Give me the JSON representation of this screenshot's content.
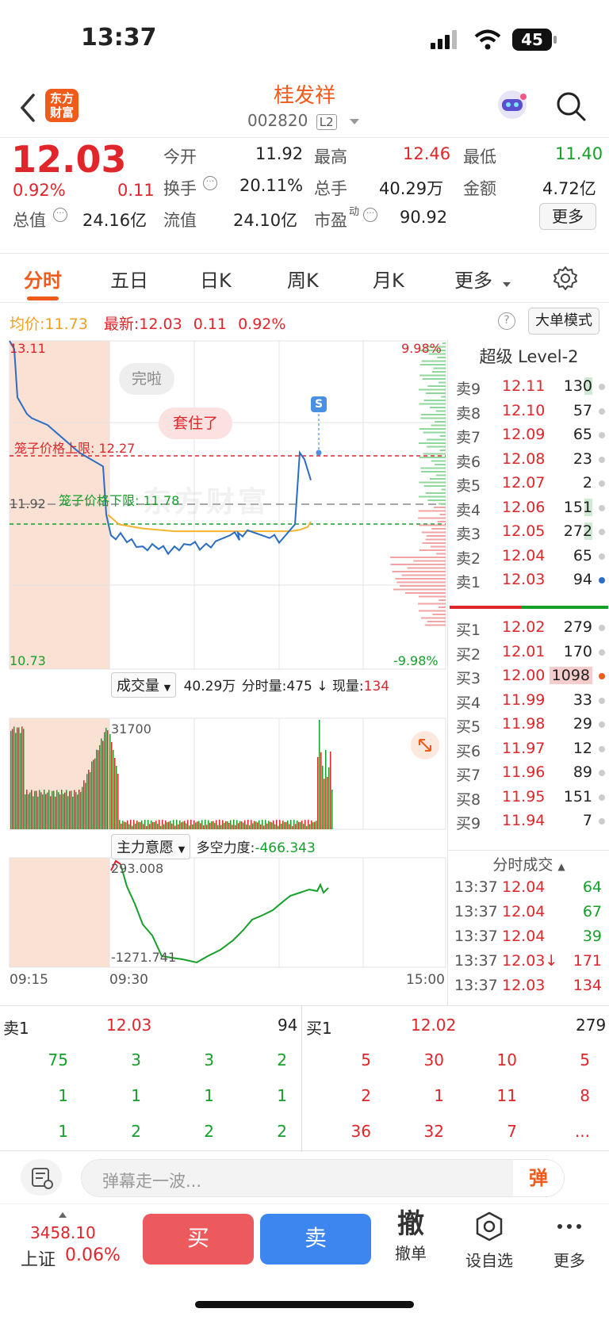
{
  "status": {
    "time": "13:37",
    "battery": "45"
  },
  "header": {
    "logo_line1": "东方",
    "logo_line2": "财富",
    "stock_name": "桂发祥",
    "stock_code": "002820",
    "level_badge": "L2"
  },
  "quote": {
    "price": "12.03",
    "change_pct": "0.92%",
    "change": "0.11",
    "open_label": "今开",
    "open": "11.92",
    "high_label": "最高",
    "high": "12.46",
    "low_label": "最低",
    "low": "11.40",
    "turnover_label": "换手",
    "turnover": "20.11%",
    "volume_label": "总手",
    "volume": "40.29万",
    "amount_label": "金额",
    "amount": "4.72亿",
    "mktcap_label": "总值",
    "mktcap": "24.16亿",
    "float_label": "流值",
    "float_cap": "24.10亿",
    "pe_label": "市盈",
    "pe_sup": "动",
    "pe": "90.92",
    "more_label": "更多"
  },
  "tabs": [
    "分时",
    "五日",
    "日K",
    "周K",
    "月K",
    "更多"
  ],
  "avgline": {
    "avg_label": "均价:",
    "avg": "11.73",
    "latest_label": "最新:",
    "latest": "12.03",
    "chg": "0.11",
    "pct": "0.92%",
    "bigorder_label": "大单模式"
  },
  "chart": {
    "top_price": "13.11",
    "bottom_price": "10.73",
    "prev_close": "11.92",
    "top_pct": "9.98%",
    "bottom_pct": "-9.98%",
    "upper_limit_label": "笼子价格上限:",
    "upper_limit": "12.27",
    "lower_limit_label": "笼子价格下限:",
    "lower_limit": "11.78",
    "tag1": "完啦",
    "tag2": "套住了",
    "s_marker": "S",
    "watermark": "东方财富",
    "vol_selector": "成交量",
    "vol_total": "40.29万",
    "vol_minute_label": "分时量:",
    "vol_minute": "475",
    "vol_now_label": "现量:",
    "vol_now": "134",
    "vol_max": "31700",
    "ind_selector": "主力意愿",
    "ind_label": "多空力度:",
    "ind_value": "-466.343",
    "ind_top": "293.008",
    "ind_bottom": "-1271.741",
    "time_start": "09:15",
    "time_open": "09:30",
    "time_end": "15:00"
  },
  "chart_data": {
    "type": "line",
    "title": "",
    "ylim": [
      10.73,
      13.11
    ],
    "x_range": [
      "09:15",
      "15:00"
    ],
    "series": [
      {
        "values": [
          13.11,
          13.05,
          12.7,
          12.58,
          12.55,
          12.5,
          12.3,
          12.2,
          11.85,
          11.7,
          11.65,
          11.62,
          11.6,
          11.62,
          11.63,
          11.64,
          11.7,
          11.72,
          11.68,
          11.78,
          12.3,
          12.25,
          12.1
        ]
      },
      {
        "values": [
          11.85,
          11.78,
          11.75,
          11.73,
          11.73,
          11.73,
          11.73,
          11.73,
          11.74,
          11.76,
          11.8
        ]
      }
    ]
  },
  "level2": {
    "title": "超级 Level-2",
    "asks": [
      {
        "label": "卖9",
        "price": "12.11",
        "vol": "130"
      },
      {
        "label": "卖8",
        "price": "12.10",
        "vol": "57"
      },
      {
        "label": "卖7",
        "price": "12.09",
        "vol": "65"
      },
      {
        "label": "卖6",
        "price": "12.08",
        "vol": "23"
      },
      {
        "label": "卖5",
        "price": "12.07",
        "vol": "2"
      },
      {
        "label": "卖4",
        "price": "12.06",
        "vol": "151"
      },
      {
        "label": "卖3",
        "price": "12.05",
        "vol": "272"
      },
      {
        "label": "卖2",
        "price": "12.04",
        "vol": "65"
      },
      {
        "label": "卖1",
        "price": "12.03",
        "vol": "94"
      }
    ],
    "bids": [
      {
        "label": "买1",
        "price": "12.02",
        "vol": "279"
      },
      {
        "label": "买2",
        "price": "12.01",
        "vol": "170"
      },
      {
        "label": "买3",
        "price": "12.00",
        "vol": "1098"
      },
      {
        "label": "买4",
        "price": "11.99",
        "vol": "33"
      },
      {
        "label": "买5",
        "price": "11.98",
        "vol": "29"
      },
      {
        "label": "买6",
        "price": "11.97",
        "vol": "12"
      },
      {
        "label": "买7",
        "price": "11.96",
        "vol": "89"
      },
      {
        "label": "买8",
        "price": "11.95",
        "vol": "151"
      },
      {
        "label": "买9",
        "price": "11.94",
        "vol": "7"
      }
    ],
    "ticks_title": "分时成交",
    "ticks": [
      {
        "time": "13:37",
        "price": "12.04",
        "vol": "64"
      },
      {
        "time": "13:37",
        "price": "12.04",
        "vol": "67"
      },
      {
        "time": "13:37",
        "price": "12.04",
        "vol": "39"
      },
      {
        "time": "13:37",
        "price": "12.03↓",
        "vol": "171"
      },
      {
        "time": "13:37",
        "price": "12.03",
        "vol": "134"
      }
    ]
  },
  "orderbook": {
    "sell_label": "卖1",
    "sell_price": "12.03",
    "sell_vol": "94",
    "buy_label": "买1",
    "buy_price": "12.02",
    "buy_vol": "279",
    "sell_queue": [
      "75",
      "3",
      "3",
      "2",
      "1",
      "1",
      "1",
      "1",
      "1",
      "2",
      "2",
      "2"
    ],
    "buy_queue": [
      "5",
      "30",
      "10",
      "5",
      "2",
      "1",
      "11",
      "8",
      "36",
      "32",
      "7",
      "..."
    ]
  },
  "danmu": {
    "placeholder": "弹幕走一波...",
    "btn": "弹"
  },
  "bottom": {
    "index_value": "3458.10",
    "index_name": "上证",
    "index_pct": "0.06%",
    "buy": "买",
    "sell": "卖",
    "cancel_glyph": "撤",
    "cancel": "撤单",
    "watch": "设自选",
    "more": "更多"
  }
}
